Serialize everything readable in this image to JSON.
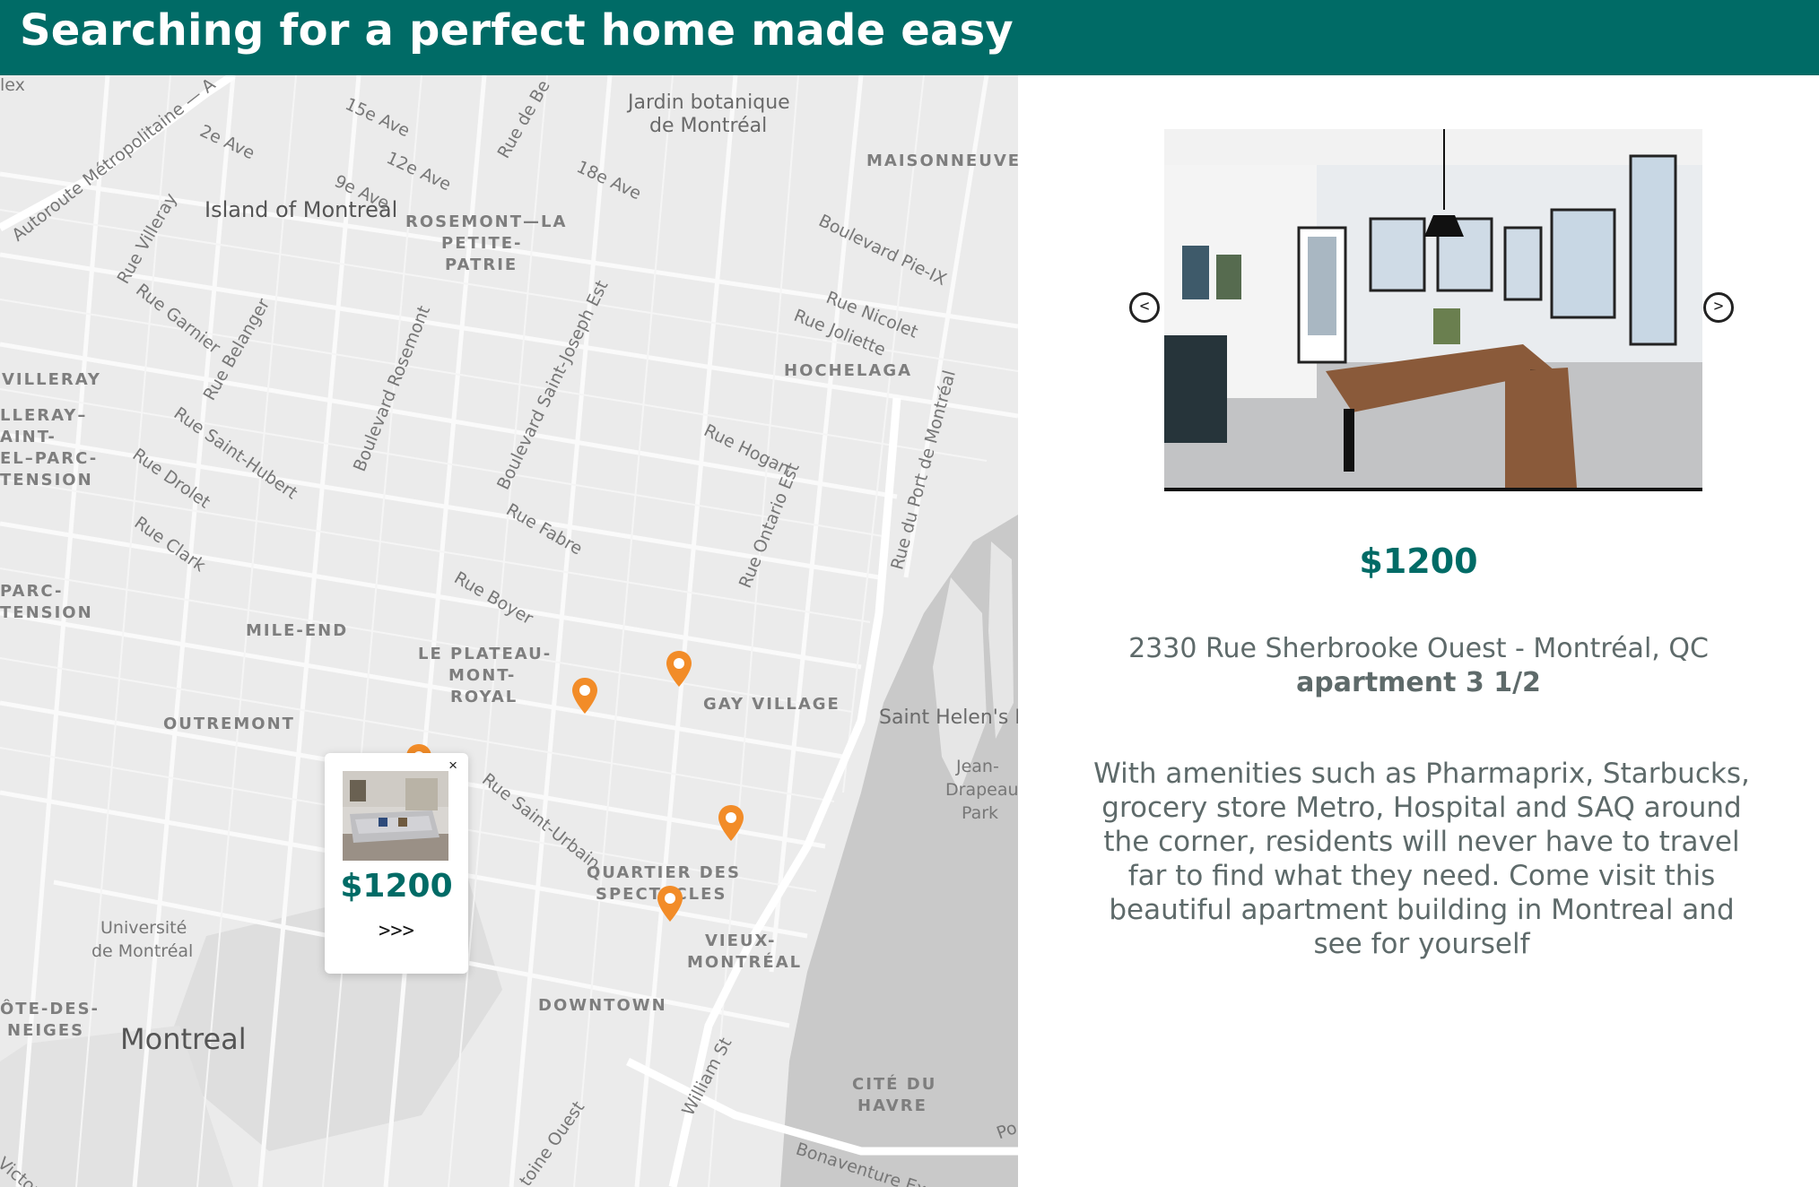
{
  "header": {
    "title": "Searching for a perfect home made easy"
  },
  "map": {
    "labels": {
      "lex": "lex",
      "ave15": "15e Ave",
      "rue_de_be": "Rue de Be",
      "jardin": "Jardin botanique",
      "jardin2": "de Montréal",
      "autoroute": "Autoroute Métropolitaine — A",
      "ave2": "2e Ave",
      "ave12": "12e Ave",
      "ave18": "18e Ave",
      "maisonneuve": "MAISONNEUVE",
      "ave9": "9e Ave",
      "island": "Island of Montreal",
      "rosemont": "ROSEMONT—LA",
      "rosemont2": "PETITE-",
      "rosemont3": "PATRIE",
      "pie_ix": "Boulevard Pie-IX",
      "villeray_rue": "Rue Villeray",
      "garnier": "Rue Garnier",
      "belanger": "Rue Belanger",
      "nicolet": "Rue Nicolet",
      "joliette": "Rue Joliette",
      "st_joseph": "Boulevard Saint-Joseph Est",
      "bd_rosemont": "Boulevard Rosemont",
      "hochelaga": "HOCHELAGA",
      "villeray": "VILLERAY",
      "vsp1": "LLERAY–",
      "vsp2": "AINT-",
      "vsp3": "EL–PARC-",
      "vsp4": "TENSION",
      "st_hubert": "Rue Saint-Hubert",
      "hogan": "Rue Hogan",
      "port": "Rue du Port de Montréal",
      "drolet": "Rue Drolet",
      "fabre": "Rue Fabre",
      "ontario": "Rue Ontario Est",
      "clark": "Rue Clark",
      "parc1": "PARC-",
      "parc2": "TENSION",
      "boyer": "Rue Boyer",
      "mile_end": "MILE-END",
      "plateau1": "LE PLATEAU-",
      "plateau2": "MONT-",
      "plateau3": "ROYAL",
      "gay_village": "GAY VILLAGE",
      "saint_helen": "Saint Helen's I",
      "outremont": "OUTREMONT",
      "st_urbain": "Rue Saint-Urbain",
      "jean1": "Jean-",
      "jean2": "Drapeau",
      "jean3": "Park",
      "quartier1": "QUARTIER DES",
      "quartier2": "SPECTACLES",
      "universite1": "Université",
      "universite2": "de Montréal",
      "vieux1": "VIEUX-",
      "vieux2": "MONTRÉAL",
      "cote1": "ÔTE-DES-",
      "cote2": "NEIGES",
      "downtown": "DOWNTOWN",
      "montreal": "Montreal",
      "william": "William St",
      "cite1": "CITÉ DU",
      "cite2": "HAVRE",
      "antoine": "toine Ouest",
      "bonaventure": "Bonaventure Exp",
      "po": "Po",
      "victoria": "Victoria"
    },
    "popup": {
      "close": "×",
      "price": "$1200",
      "more": ">>>"
    }
  },
  "listing": {
    "prev": "<",
    "next": ">",
    "price": "$1200",
    "address": "2330 Rue Sherbrooke Ouest - Montréal, QC",
    "type": "apartment 3 1/2",
    "description": "With amenities such as Pharmaprix, Starbucks, grocery store Metro, Hospital and SAQ around the corner, residents will never have to travel far to find what they need. Come visit this beautiful apartment building in Montreal and see for yourself"
  },
  "colors": {
    "brand": "#006b66",
    "pin": "#f28c28",
    "text": "#5e6a6a"
  }
}
